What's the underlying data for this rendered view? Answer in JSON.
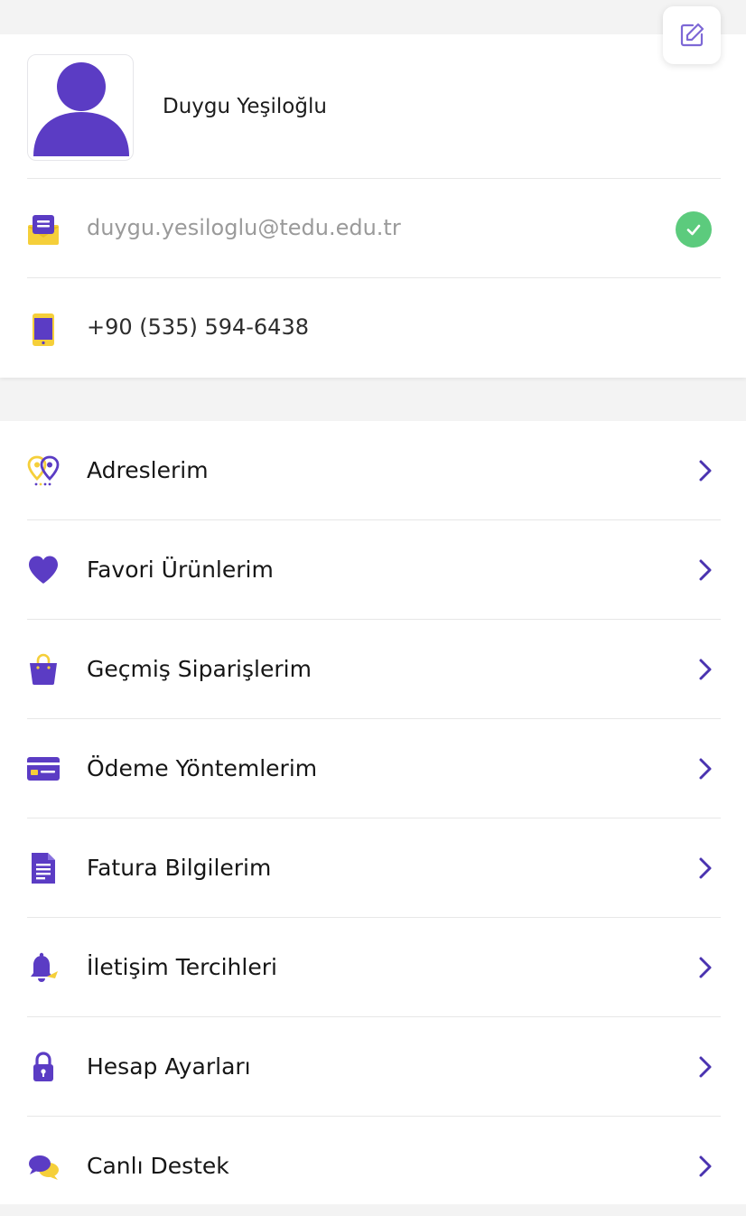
{
  "user": {
    "name": "Duygu Yeşiloğlu",
    "email": "duygu.yesiloglu@tedu.edu.tr",
    "email_verified": true,
    "phone": "+90 (535) 594-6438"
  },
  "icons": {
    "edit": "edit-icon",
    "avatar": "user-avatar-icon",
    "email": "envelope-icon",
    "phone": "phone-icon",
    "verified": "check-circle-icon",
    "chevron": "chevron-right-icon"
  },
  "colors": {
    "primary": "#5b3cc4",
    "accent": "#f5cf3a",
    "success": "#5ccb7d",
    "chevron": "#4a33b0"
  },
  "menu": [
    {
      "label": "Adreslerim",
      "icon": "location-pin-icon"
    },
    {
      "label": "Favori Ürünlerim",
      "icon": "heart-icon"
    },
    {
      "label": "Geçmiş Siparişlerim",
      "icon": "shopping-bag-icon"
    },
    {
      "label": "Ödeme Yöntemlerim",
      "icon": "credit-card-icon"
    },
    {
      "label": "Fatura Bilgilerim",
      "icon": "document-icon"
    },
    {
      "label": "İletişim Tercihleri",
      "icon": "bell-icon"
    },
    {
      "label": "Hesap Ayarları",
      "icon": "lock-icon"
    },
    {
      "label": "Canlı Destek",
      "icon": "chat-bubbles-icon"
    }
  ]
}
